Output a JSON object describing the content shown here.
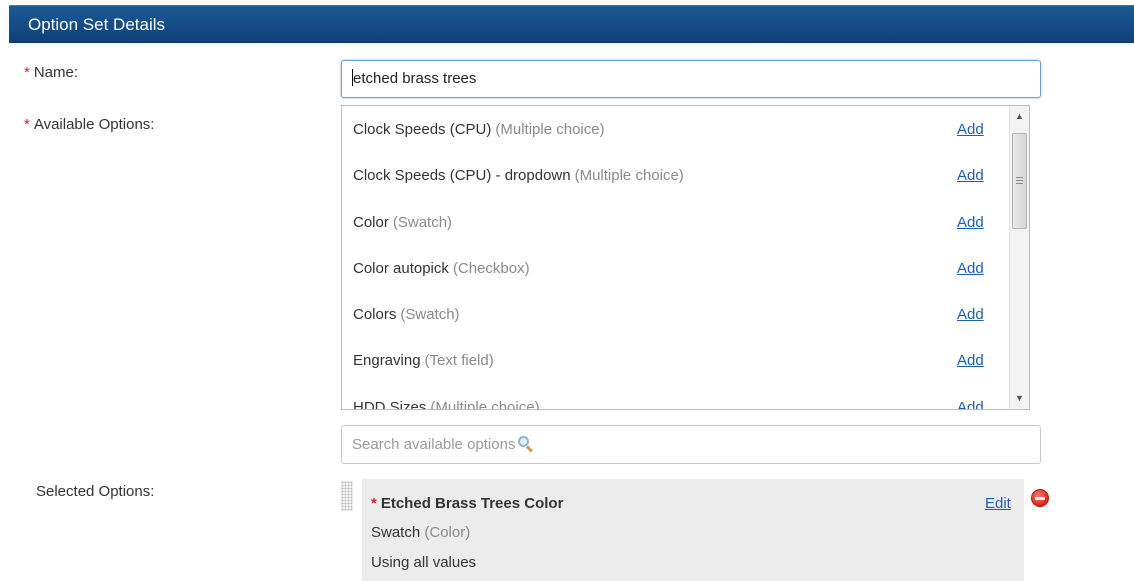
{
  "header": {
    "title": "Option Set Details"
  },
  "form": {
    "required_marker": "*",
    "name_label": "Name:",
    "name_value": "etched brass trees",
    "available_label": "Available Options:",
    "selected_label": "Selected Options:",
    "search_placeholder": "Search available options"
  },
  "available_options": [
    {
      "name": "Clock Speeds (CPU)",
      "type": "(Multiple choice)",
      "action": "Add"
    },
    {
      "name": "Clock Speeds (CPU) - dropdown",
      "type": "(Multiple choice)",
      "action": "Add"
    },
    {
      "name": "Color",
      "type": "(Swatch)",
      "action": "Add"
    },
    {
      "name": "Color autopick",
      "type": "(Checkbox)",
      "action": "Add"
    },
    {
      "name": "Colors",
      "type": "(Swatch)",
      "action": "Add"
    },
    {
      "name": "Engraving",
      "type": "(Text field)",
      "action": "Add"
    },
    {
      "name": "HDD Sizes",
      "type": "(Multiple choice)",
      "action": "Add"
    }
  ],
  "selected_option": {
    "name": "Etched Brass Trees Color",
    "type": "Swatch",
    "type_detail": "(Color)",
    "values": "Using all values",
    "edit_label": "Edit"
  },
  "icons": {
    "scroll_up": "scroll-up-arrow-icon",
    "scroll_down": "scroll-down-arrow-icon",
    "search": "magnifier-icon",
    "remove": "remove-circle-icon",
    "drag": "drag-handle-icon"
  },
  "colors": {
    "header_bg": "#0d4076",
    "required": "#d0202a",
    "link": "#1a5fb4",
    "remove": "#d92516"
  }
}
